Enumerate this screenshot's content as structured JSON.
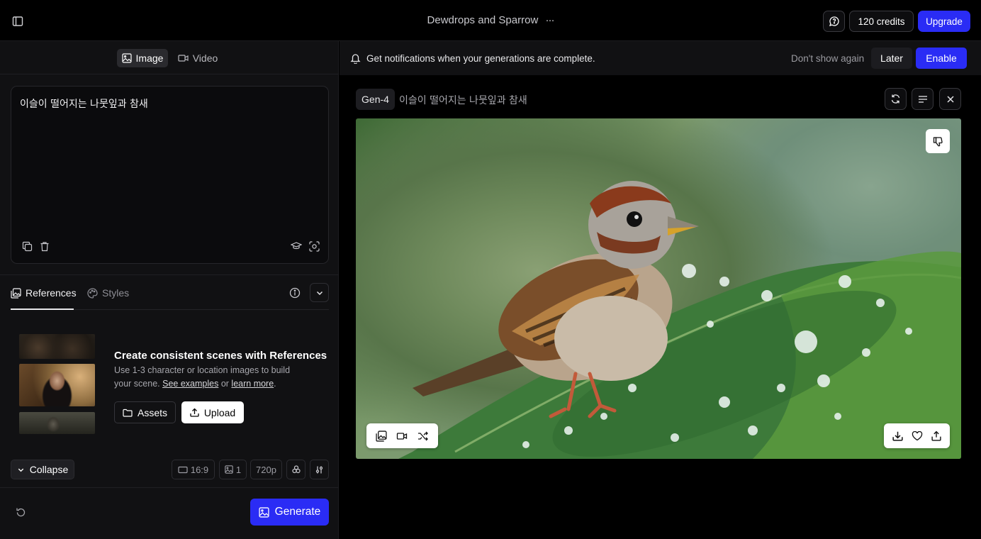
{
  "header": {
    "title": "Dewdrops and Sparrow",
    "more": "···",
    "credits": "120 credits",
    "upgrade": "Upgrade"
  },
  "mode_tabs": {
    "image": "Image",
    "video": "Video"
  },
  "prompt": {
    "text": "이슬이 떨어지는 나뭇잎과 참새"
  },
  "ref_tabs": {
    "references": "References",
    "styles": "Styles"
  },
  "references": {
    "heading": "Create consistent scenes with References",
    "desc_1": "Use 1-3 character or location images to build",
    "desc_2a": "your scene.",
    "link_examples": "See examples",
    "desc_or": "or",
    "link_learn": "learn more",
    "desc_end": ".",
    "assets": "Assets",
    "upload": "Upload"
  },
  "settings": {
    "collapse": "Collapse",
    "ratio": "16:9",
    "count": "1",
    "resolution": "720p"
  },
  "generate": "Generate",
  "notification": {
    "text": "Get notifications when your generations are complete.",
    "dont_show": "Don't show again",
    "later": "Later",
    "enable": "Enable"
  },
  "result": {
    "model": "Gen-4",
    "prompt": "이슬이 떨어지는 나뭇잎과 참새"
  },
  "colors": {
    "accent": "#2a2cf5",
    "panel": "#111113",
    "bg": "#000000"
  }
}
